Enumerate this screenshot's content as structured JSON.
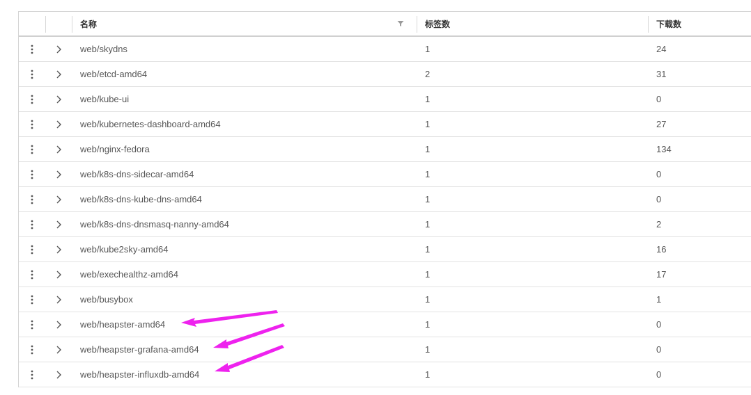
{
  "table": {
    "headers": {
      "name": "名称",
      "tags": "标签数",
      "downloads": "下载数"
    },
    "rows": [
      {
        "name": "web/skydns",
        "tags": "1",
        "downloads": "24"
      },
      {
        "name": "web/etcd-amd64",
        "tags": "2",
        "downloads": "31"
      },
      {
        "name": "web/kube-ui",
        "tags": "1",
        "downloads": "0"
      },
      {
        "name": "web/kubernetes-dashboard-amd64",
        "tags": "1",
        "downloads": "27"
      },
      {
        "name": "web/nginx-fedora",
        "tags": "1",
        "downloads": "134"
      },
      {
        "name": "web/k8s-dns-sidecar-amd64",
        "tags": "1",
        "downloads": "0"
      },
      {
        "name": "web/k8s-dns-kube-dns-amd64",
        "tags": "1",
        "downloads": "0"
      },
      {
        "name": "web/k8s-dns-dnsmasq-nanny-amd64",
        "tags": "1",
        "downloads": "2"
      },
      {
        "name": "web/kube2sky-amd64",
        "tags": "1",
        "downloads": "16"
      },
      {
        "name": "web/exechealthz-amd64",
        "tags": "1",
        "downloads": "17"
      },
      {
        "name": "web/busybox",
        "tags": "1",
        "downloads": "1"
      },
      {
        "name": "web/heapster-amd64",
        "tags": "1",
        "downloads": "0"
      },
      {
        "name": "web/heapster-grafana-amd64",
        "tags": "1",
        "downloads": "0"
      },
      {
        "name": "web/heapster-influxdb-amd64",
        "tags": "1",
        "downloads": "0"
      }
    ]
  },
  "icons": {
    "row_menu": "kebab-vertical-icon",
    "row_expand": "chevron-right-icon",
    "column_filter": "filter-funnel-icon",
    "annotation": "arrow-left-icon"
  },
  "colors": {
    "annotation_arrow": "#ee22ee",
    "text": "#565656",
    "header_text": "#333333",
    "border": "#d4d4d4"
  }
}
